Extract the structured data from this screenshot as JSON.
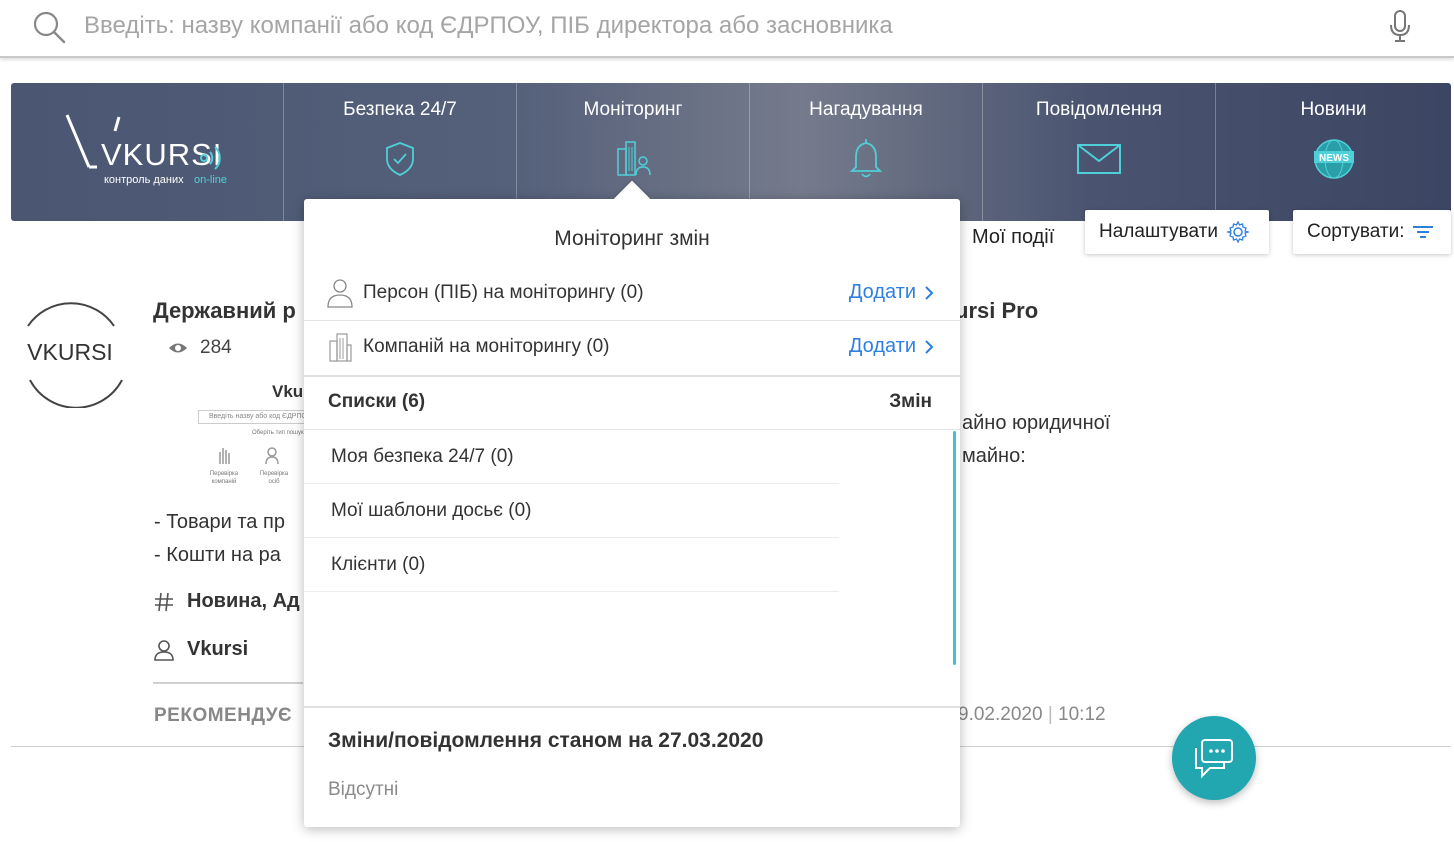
{
  "search": {
    "placeholder": "Введіть: назву компанії або код ЄДРПОУ, ПІБ директора або засновника"
  },
  "logo": {
    "brand": "VKURSI",
    "tagline_prefix": "контроль даних",
    "tagline_accent": "on-line"
  },
  "nav": [
    {
      "label": "Безпека 24/7",
      "icon": "shield-check-icon"
    },
    {
      "label": "Моніторинг",
      "icon": "buildings-person-icon"
    },
    {
      "label": "Нагадування",
      "icon": "bell-icon"
    },
    {
      "label": "Повідомлення",
      "icon": "envelope-icon"
    },
    {
      "label": "Новини",
      "icon": "news-globe-icon",
      "badge": "NEWS"
    }
  ],
  "toolbar": {
    "my_events": "Мої події",
    "settings": "Налаштувати",
    "sort": "Сортувати:"
  },
  "article": {
    "avatar_text": "VKURSI",
    "title_start": "Державний р",
    "title_end": "ursi Pro",
    "views": "284",
    "thumb_title": "Vku",
    "thumb_search": "Введіть назву або код ЄДРПОУ",
    "thumb_sub": "Оберіть тип пошук",
    "thumb_item1": "Перевірка компаній",
    "thumb_item2": "Перевірка осіб",
    "right_line1": "айно юридичної",
    "right_line2": "майно:",
    "line1": "- Товари та пр",
    "line2": "- Кошти на ра",
    "tags": "Новина, Ад",
    "author": "Vkursi",
    "recommend": "РЕКОМЕНДУЄ",
    "date": "9.02.2020",
    "time": "10:12"
  },
  "dropdown": {
    "title": "Моніторинг змін",
    "persons": {
      "label": "Персон (ПІБ) на моніторингу (0)",
      "action": "Додати"
    },
    "companies": {
      "label": "Компаній на моніторингу (0)",
      "action": "Додати"
    },
    "lists_header": "Списки (6)",
    "changes_header": "Змін",
    "lists": [
      "Моя безпека 24/7 (0)",
      "Мої шаблони досьє (0)",
      "Клієнти (0)"
    ],
    "changes_title": "Зміни/повідомлення станом на 27.03.2020",
    "changes_value": "Відсутні"
  },
  "colors": {
    "accent": "#3fc2c9",
    "link": "#2f7fe0",
    "chat": "#22a6b0",
    "nav_bg": "#4a5672"
  }
}
